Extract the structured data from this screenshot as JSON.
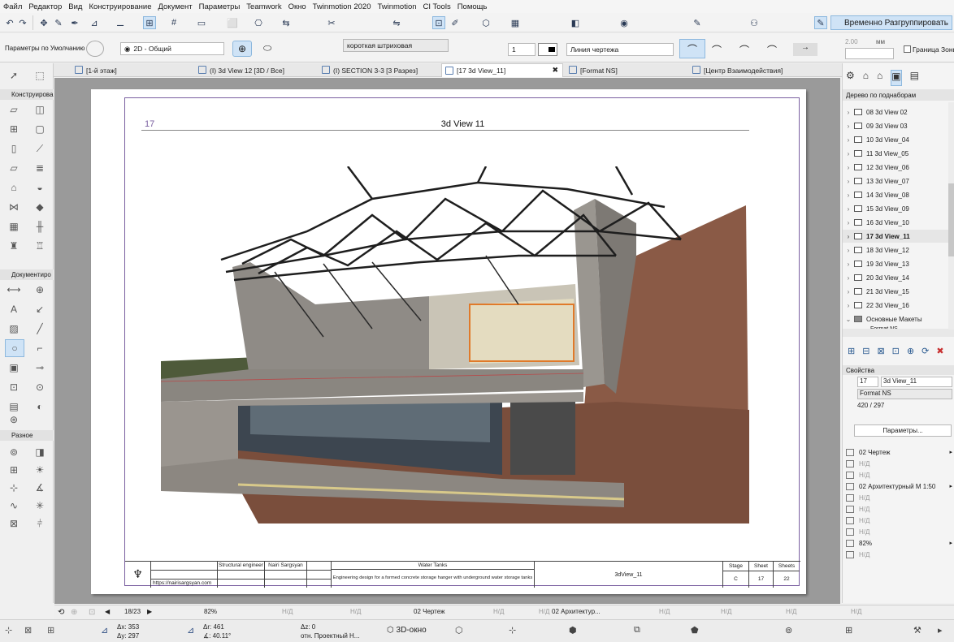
{
  "menu": [
    "Файл",
    "Редактор",
    "Вид",
    "Конструирование",
    "Документ",
    "Параметры",
    "Teamwork",
    "Окно",
    "Twinmotion 2020",
    "Twinmotion",
    "CI Tools",
    "Помощь"
  ],
  "toolbar": {
    "ungroup_label": "Временно Разгруппировать",
    "defaults_label": "Параметры по Умолчанию",
    "view_mode": "2D - Общий",
    "line_type": "короткая штриховая",
    "pen_value": "1",
    "line_label": "Линия чертежа",
    "offset_value": "2.00",
    "unit_label": "мм",
    "zone_border_label": "Граница Зоны"
  },
  "tabs": [
    {
      "label": "[1-й этаж]"
    },
    {
      "label": "(I) 3d View 12 [3D / Все]"
    },
    {
      "label": "(I) SECTION 3-3 [3 Разрез]"
    },
    {
      "label": "[17 3d View_11]"
    },
    {
      "label": "[Format NS]"
    },
    {
      "label": "[Центр Взаимодействия]"
    }
  ],
  "toolbox": {
    "section_design": "Конструирова",
    "section_document": "Документиро",
    "section_misc": "Разное"
  },
  "drawing": {
    "number": "17",
    "title": "3d View 11"
  },
  "titleblock": {
    "role": "Structural engineer",
    "person": "Nairi Sargsyan",
    "website": "https://nairisargsyan.com",
    "project": "Water Tanks",
    "description": "Engineering design for a formed concrete storage hanger with underground water storage tanks",
    "sheet_name": "3dView_11",
    "stage_label": "Stage",
    "sheet_label": "Sheet",
    "sheets_label": "Sheets",
    "stage_value": "C",
    "sheet_value": "17",
    "sheets_value": "22"
  },
  "rightpanel": {
    "tree_title": "Дерево по поднаборам",
    "items": [
      {
        "label": "08 3d View 02"
      },
      {
        "label": "09 3d View 03"
      },
      {
        "label": "10 3d View_04"
      },
      {
        "label": "11 3d View_05"
      },
      {
        "label": "12 3d View_06"
      },
      {
        "label": "13 3d View_07"
      },
      {
        "label": "14 3d View_08"
      },
      {
        "label": "15 3d View_09"
      },
      {
        "label": "16 3d View_10"
      },
      {
        "label": "17 3d View_11"
      },
      {
        "label": "18 3d View_12"
      },
      {
        "label": "19 3d View_13"
      },
      {
        "label": "20 3d View_14"
      },
      {
        "label": "21 3d View_15"
      },
      {
        "label": "22 3d View_16"
      }
    ],
    "folder": "Основные Макеты",
    "folder_child": "Format NS",
    "props_title": "Свойства",
    "prop_num": "17",
    "prop_name": "3d View_11",
    "prop_format": "Format NS",
    "prop_size": "420 / 297",
    "params_button": "Параметры...",
    "layers": [
      {
        "label": "02 Чертеж",
        "dim": false
      },
      {
        "label": "Н/Д",
        "dim": true
      },
      {
        "label": "Н/Д",
        "dim": true
      },
      {
        "label": "02 Архитектурный М 1:50",
        "dim": false
      },
      {
        "label": "Н/Д",
        "dim": true
      },
      {
        "label": "Н/Д",
        "dim": true
      },
      {
        "label": "Н/Д",
        "dim": true
      },
      {
        "label": "Н/Д",
        "dim": true
      },
      {
        "label": "82%",
        "dim": false
      },
      {
        "label": "Н/Д",
        "dim": true
      }
    ]
  },
  "navbar": {
    "page": "18/23",
    "zoom": "82%",
    "nd1": "Н/Д",
    "nd2": "Н/Д",
    "layer": "02 Чертеж",
    "nd3": "Н/Д",
    "nd4": "Н/Д",
    "scale": "02 Архитектур...",
    "nd5": "Н/Д",
    "nd6": "Н/Д",
    "nd7": "Н/Д",
    "nd8": "Н/Д"
  },
  "status": {
    "dx": "Δx: 353",
    "dy": "Δy: 297",
    "dr": "Δr: 461",
    "angle": "∡: 40.11°",
    "dz": "Δz: 0",
    "ref": "отн. Проектный Н...",
    "view3d": "3D-окно"
  },
  "colors": {
    "accent": "#cfe3f6",
    "frame": "#7a5fa0",
    "canvas_bg": "#9a9a9a"
  }
}
